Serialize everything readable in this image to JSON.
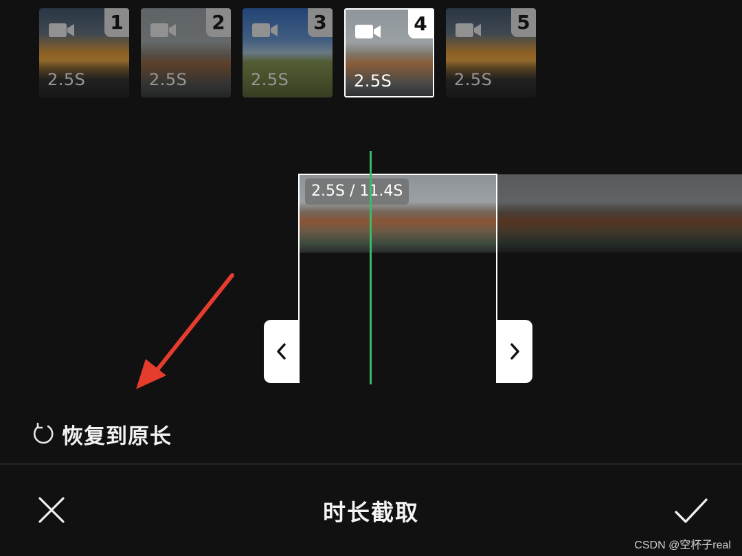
{
  "clips": [
    {
      "index": "1",
      "duration": "2.5S",
      "scene": "sunset",
      "selected": false
    },
    {
      "index": "2",
      "duration": "2.5S",
      "scene": "city",
      "selected": false
    },
    {
      "index": "3",
      "duration": "2.5S",
      "scene": "field",
      "selected": false
    },
    {
      "index": "4",
      "duration": "2.5S",
      "scene": "city",
      "selected": true
    },
    {
      "index": "5",
      "duration": "2.5S",
      "scene": "sunset",
      "selected": false
    }
  ],
  "clip_icon": "video-camera-icon",
  "trimmer": {
    "duration_label": "2.5S / 11.4S",
    "left_handle_icon": "chevron-left-icon",
    "right_handle_icon": "chevron-right-icon",
    "playhead_color": "#3dbb63"
  },
  "restore": {
    "label": "恢复到原长",
    "icon": "refresh-icon"
  },
  "bottom_bar": {
    "title": "时长截取",
    "close_icon": "close-icon",
    "confirm_icon": "checkmark-icon"
  },
  "annotation": {
    "icon": "arrow-icon",
    "color": "#e53c2e"
  },
  "watermark": "CSDN @空杯子real"
}
